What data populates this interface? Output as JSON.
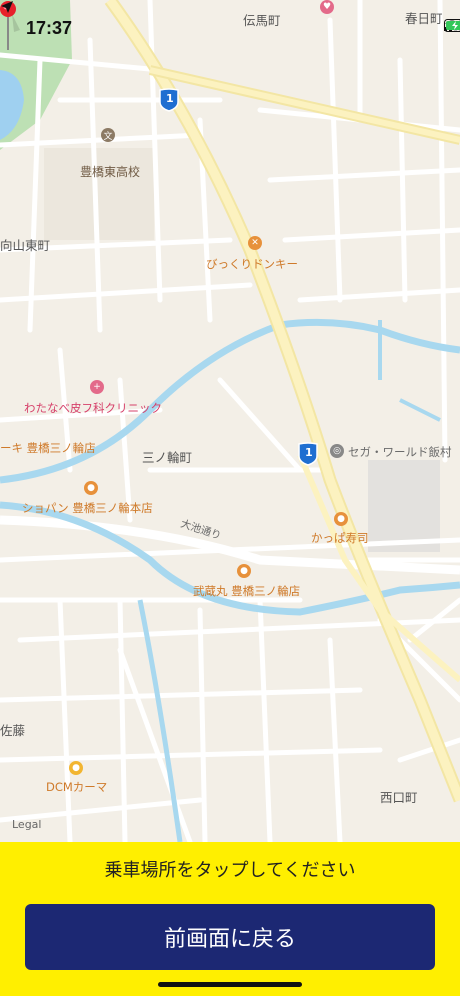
{
  "status": {
    "time": "17:37",
    "icons": [
      "location-arrow-icon",
      "signal-icon",
      "wifi-icon",
      "battery-charging-icon"
    ]
  },
  "map": {
    "labels": {
      "denmacho": "伝馬町",
      "kasugacho": "春日町",
      "highschool": "豊橋東高校",
      "mukaiyamahigashi": "向山東町",
      "bikkuri": "びっくりドンキー",
      "watanabe": "わたなべ皮フ科クリニック",
      "cake": "ーキ 豊橋三ノ輪店",
      "sannowa": "三ノ輪町",
      "sega": "セガ・ワールド飯村",
      "chopin": "ショパン 豊橋三ノ輪本店",
      "kappa": "かっぱ寿司",
      "oike": "大池通り",
      "musashimaru": "武蔵丸 豊橋三ノ輪店",
      "sato": "佐藤",
      "dcm": "DCMカーマ",
      "nishiguchi": "西口町",
      "legal": "Legal",
      "route1": "1"
    }
  },
  "panel": {
    "instruction": "乗車場所をタップしてください",
    "back_button": "前画面に戻る"
  }
}
